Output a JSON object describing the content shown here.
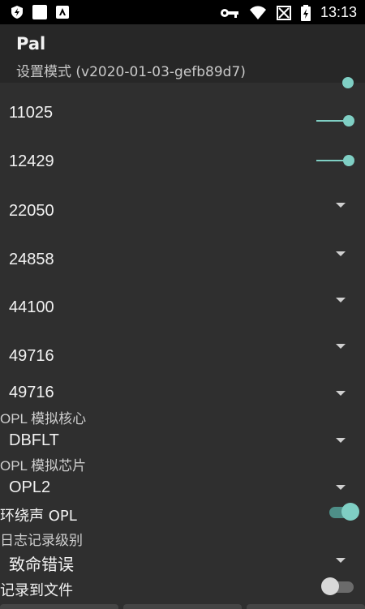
{
  "statusbar": {
    "time": "13:13",
    "icons": [
      "shield-bolt-icon",
      "app-square-icon",
      "autofill-icon",
      "key-icon",
      "wifi-icon",
      "no-signal-icon",
      "battery-charging-icon"
    ]
  },
  "app": {
    "title": "Pal",
    "subtitle": "设置模式 (v2020-01-03-gefb89d7)"
  },
  "sample_rows": [
    {
      "value": "11025",
      "control": "slider"
    },
    {
      "value": "12429",
      "control": "slider"
    },
    {
      "value": "22050",
      "control": "dropdown"
    },
    {
      "value": "24858",
      "control": "dropdown"
    },
    {
      "value": "44100",
      "control": "dropdown"
    },
    {
      "value": "49716",
      "control": "dropdown"
    },
    {
      "value": "49716",
      "control": "dropdown"
    }
  ],
  "opl_core": {
    "label": "OPL 模拟核心",
    "value": "DBFLT"
  },
  "opl_chip": {
    "label": "OPL 模拟芯片",
    "value": "OPL2"
  },
  "surround_opl": {
    "label": "环绕声 OPL",
    "enabled": true
  },
  "log_level": {
    "label": "日志记录级别",
    "value": "致命错误"
  },
  "log_to_file": {
    "label": "记录到文件",
    "enabled": false
  },
  "colors": {
    "accent": "#7fcfc4",
    "background": "#2f2f2f",
    "appbar": "#272727"
  }
}
